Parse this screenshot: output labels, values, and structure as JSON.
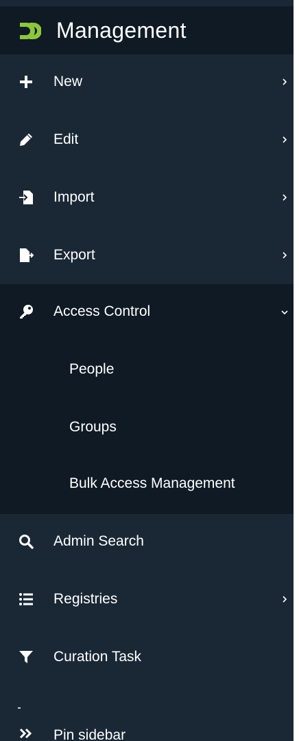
{
  "colors": {
    "sidebar_bg": "#1a2836",
    "header_bg": "#0f1a24",
    "expanded_bg": "#0f1a24",
    "logo_green": "#8cc63f",
    "text": "#ffffff"
  },
  "header": {
    "title": "Management",
    "logo_icon": "dspace-logo-icon"
  },
  "menu": {
    "new": {
      "label": "New",
      "icon": "plus-icon",
      "has_submenu": true
    },
    "edit": {
      "label": "Edit",
      "icon": "pencil-icon",
      "has_submenu": true
    },
    "import": {
      "label": "Import",
      "icon": "file-import-icon",
      "has_submenu": true
    },
    "export": {
      "label": "Export",
      "icon": "file-export-icon",
      "has_submenu": true
    },
    "access_control": {
      "label": "Access Control",
      "icon": "key-icon",
      "expanded": true,
      "items": [
        {
          "label": "People"
        },
        {
          "label": "Groups"
        },
        {
          "label": "Bulk Access Management"
        }
      ]
    },
    "admin_search": {
      "label": "Admin Search",
      "icon": "search-icon",
      "has_submenu": false
    },
    "registries": {
      "label": "Registries",
      "icon": "list-icon",
      "has_submenu": true
    },
    "curation_task": {
      "label": "Curation Task",
      "icon": "filter-icon",
      "has_submenu": false
    }
  },
  "footer": {
    "pin_label": "Pin sidebar",
    "pin_icon": "double-chevron-right-icon"
  }
}
